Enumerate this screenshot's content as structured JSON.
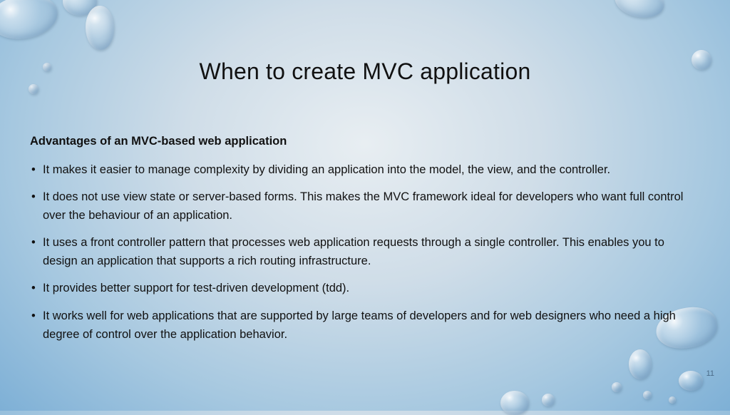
{
  "title": "When to create MVC application",
  "subhead": "Advantages of an MVC-based web application",
  "bullets": [
    "It makes it easier to manage complexity by dividing an application into the model, the view, and the controller.",
    "It does not use view state or server-based forms. This makes the MVC framework ideal for developers who want full control over the behaviour of an application.",
    "It uses a front controller pattern that processes web application requests through a single controller. This enables you to design an application that supports a rich routing infrastructure.",
    "It provides better support for test-driven development (tdd).",
    "It works well for web applications that are supported by large teams of developers and for web designers who need a high degree of control over the application behavior."
  ],
  "page_number": "11"
}
